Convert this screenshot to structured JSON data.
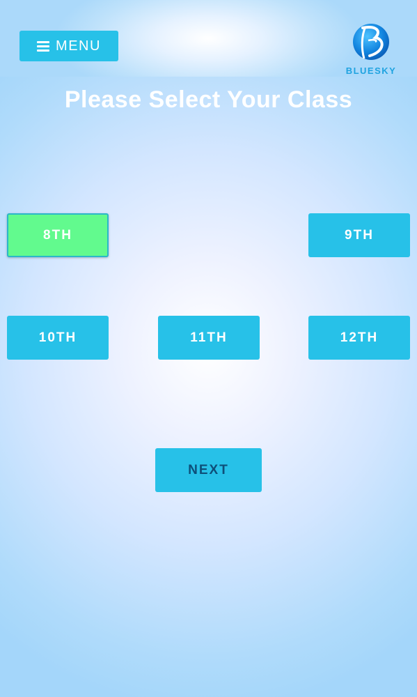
{
  "header": {
    "menu_label": "MENU",
    "logo_text": "BLUESKY"
  },
  "page": {
    "title": "Please Select Your Class"
  },
  "classes": [
    {
      "label": "8TH",
      "selected": true
    },
    {
      "label": "9TH",
      "selected": false
    },
    {
      "label": "10TH",
      "selected": false
    },
    {
      "label": "11TH",
      "selected": false
    },
    {
      "label": "12TH",
      "selected": false
    }
  ],
  "actions": {
    "next_label": "NEXT"
  },
  "colors": {
    "button": "#27c1e8",
    "selected_button": "#62fa8e",
    "next_text": "#0e4f79",
    "logo": "#1fa3e0"
  },
  "icons": {
    "menu": "hamburger-icon",
    "logo": "bluesky-logo-icon"
  }
}
